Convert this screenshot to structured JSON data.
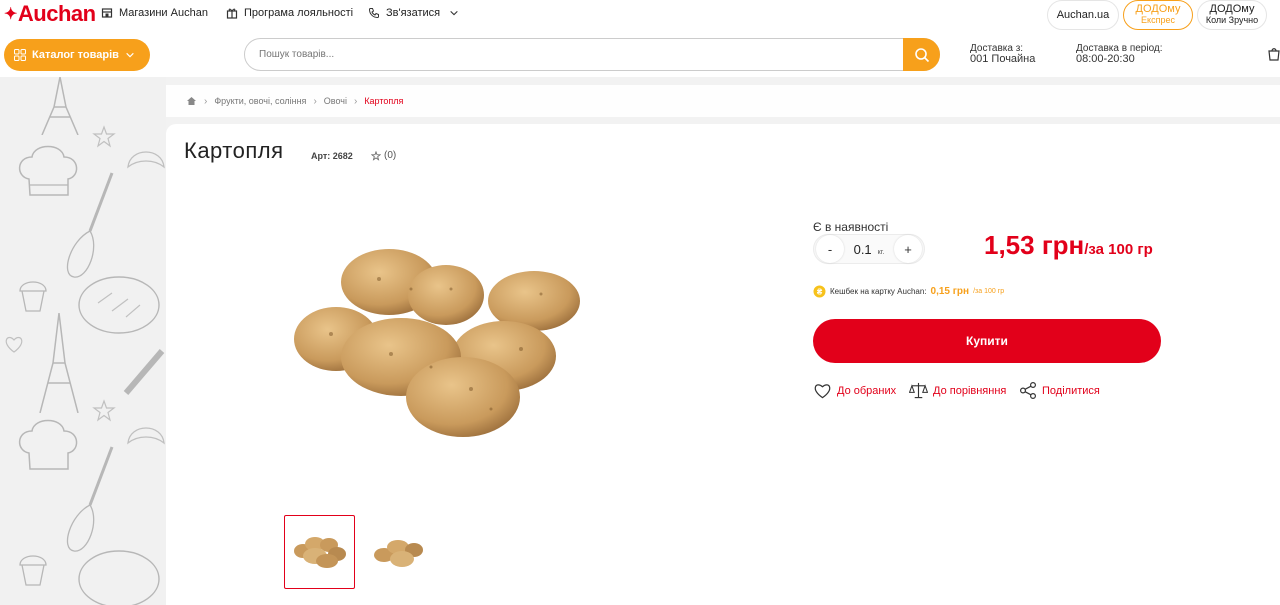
{
  "header": {
    "logo_text": "Auchan",
    "links": [
      {
        "label": "Магазини Auchan",
        "icon": "store-icon"
      },
      {
        "label": "Програма лояльності",
        "icon": "gift-icon"
      },
      {
        "label": "Зв'язатися",
        "icon": "phone-icon"
      }
    ],
    "site_pill": "Auchan.ua",
    "express_pill": {
      "title": "ДОДОму",
      "sub": "Експрес"
    },
    "convenient_pill": {
      "title": "ДОДОму",
      "sub": "Коли Зручно"
    }
  },
  "nav": {
    "catalog_label": "Каталог товарів",
    "search_placeholder": "Пошук товарів...",
    "delivery_from_label": "Доставка з:",
    "delivery_from_value": "001 Почайна",
    "delivery_period_label": "Доставка в період:",
    "delivery_period_value": "08:00-20:30"
  },
  "breadcrumb": {
    "items": [
      "Фрукти, овочі, соління",
      "Овочі"
    ],
    "current": "Картопля"
  },
  "product": {
    "title": "Картопля",
    "article": "Арт: 2682",
    "rating_count": "(0)",
    "availability": "Є в наявності",
    "quantity": "0.1",
    "quantity_unit": "кг.",
    "minus_label": "-",
    "plus_label": "+",
    "price": "1,53 грн",
    "price_per": "/за 100 гр",
    "cashback_label": "Кешбек на картку Auchan:",
    "cashback_value": "0,15 грн",
    "cashback_per": "/за 100 гр",
    "buy_label": "Купити",
    "actions": {
      "favorites": "До обраних",
      "compare": "До порівняння",
      "share": "Поділитися"
    }
  },
  "colors": {
    "brand_red": "#e2001a",
    "accent_orange": "#f7a01b"
  }
}
